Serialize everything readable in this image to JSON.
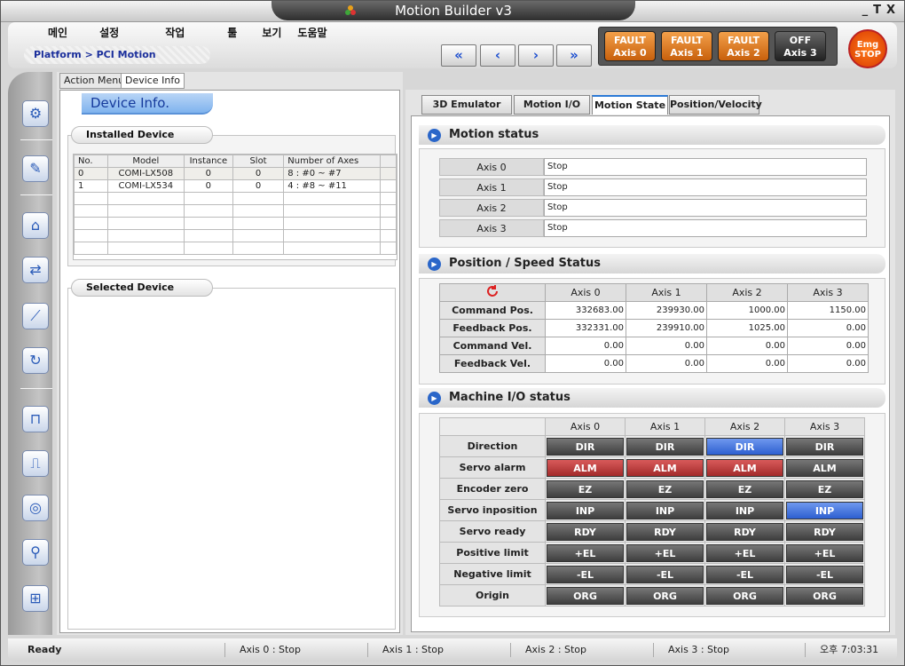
{
  "window": {
    "title": "Motion Builder v3",
    "controls": [
      "_",
      "T",
      "X"
    ]
  },
  "menu": [
    "메인",
    "설정",
    "작업",
    "툴",
    "보기",
    "도움말"
  ],
  "breadcrumb": "Platform > PCI Motion",
  "nav": [
    "«",
    "‹",
    "›",
    "»"
  ],
  "axis_buttons": [
    {
      "state": "FAULT",
      "label": "Axis  0"
    },
    {
      "state": "FAULT",
      "label": "Axis  1"
    },
    {
      "state": "FAULT",
      "label": "Axis  2"
    },
    {
      "state": "OFF",
      "label": "Axis  3"
    }
  ],
  "emg": {
    "line1": "Emg",
    "line2": "STOP"
  },
  "sidebar_icons": [
    "platform-icon",
    "tools-icon",
    "home-icon",
    "transfer-icon",
    "ruler-icon",
    "rotate-icon",
    "signal-icon",
    "pulse-icon",
    "disc-icon",
    "probe-icon",
    "network-icon"
  ],
  "left": {
    "tabs": [
      "Action Menu",
      "Device Info"
    ],
    "title": "Device Info.",
    "installed_header": "Installed Device",
    "selected_header": "Selected Device",
    "columns": [
      "No.",
      "Model",
      "Instance",
      "Slot",
      "Number of Axes"
    ],
    "rows": [
      [
        "0",
        "COMI-LX508",
        "0",
        "0",
        "8 : #0 ~ #7"
      ],
      [
        "1",
        "COMI-LX534",
        "0",
        "0",
        "4 : #8 ~ #11"
      ]
    ]
  },
  "right": {
    "tabs": [
      "3D Emulator",
      "Motion I/O",
      "Motion State",
      "Position/Velocity"
    ],
    "motion_status": {
      "title": "Motion status",
      "rows": [
        {
          "axis": "Axis 0",
          "value": "Stop"
        },
        {
          "axis": "Axis 1",
          "value": "Stop"
        },
        {
          "axis": "Axis 2",
          "value": "Stop"
        },
        {
          "axis": "Axis 3",
          "value": "Stop"
        }
      ]
    },
    "pos_speed": {
      "title": "Position / Speed Status",
      "axes": [
        "Axis 0",
        "Axis 1",
        "Axis 2",
        "Axis 3"
      ],
      "rows": [
        {
          "label": "Command Pos.",
          "values": [
            "332683.00",
            "239930.00",
            "1000.00",
            "1150.00"
          ]
        },
        {
          "label": "Feedback Pos.",
          "values": [
            "332331.00",
            "239910.00",
            "1025.00",
            "0.00"
          ]
        },
        {
          "label": "Command Vel.",
          "values": [
            "0.00",
            "0.00",
            "0.00",
            "0.00"
          ]
        },
        {
          "label": "Feedback Vel.",
          "values": [
            "0.00",
            "0.00",
            "0.00",
            "0.00"
          ]
        }
      ]
    },
    "machine_io": {
      "title": "Machine I/O status",
      "axes": [
        "Axis 0",
        "Axis 1",
        "Axis 2",
        "Axis 3"
      ],
      "rows": [
        {
          "label": "Direction",
          "code": "DIR",
          "states": [
            "off",
            "off",
            "blue",
            "off"
          ]
        },
        {
          "label": "Servo alarm",
          "code": "ALM",
          "states": [
            "red",
            "red",
            "red",
            "off"
          ]
        },
        {
          "label": "Encoder zero",
          "code": "EZ",
          "states": [
            "off",
            "off",
            "off",
            "off"
          ]
        },
        {
          "label": "Servo inposition",
          "code": "INP",
          "states": [
            "off",
            "off",
            "off",
            "blue"
          ]
        },
        {
          "label": "Servo ready",
          "code": "RDY",
          "states": [
            "off",
            "off",
            "off",
            "off"
          ]
        },
        {
          "label": "Positive limit",
          "code": "+EL",
          "states": [
            "off",
            "off",
            "off",
            "off"
          ]
        },
        {
          "label": "Negative  limit",
          "code": "-EL",
          "states": [
            "off",
            "off",
            "off",
            "off"
          ]
        },
        {
          "label": "Origin",
          "code": "ORG",
          "states": [
            "off",
            "off",
            "off",
            "off"
          ]
        }
      ]
    }
  },
  "status": {
    "ready": "Ready",
    "axes": [
      "Axis 0 :  Stop",
      "Axis 1 :  Stop",
      "Axis 2 :  Stop",
      "Axis 3 :  Stop"
    ],
    "time": "오후 7:03:31"
  },
  "colors": {
    "fault": "#e07a1e",
    "blue_led": "#3d6fe0",
    "red_led": "#c03a3a",
    "accent": "#2a66c9"
  }
}
